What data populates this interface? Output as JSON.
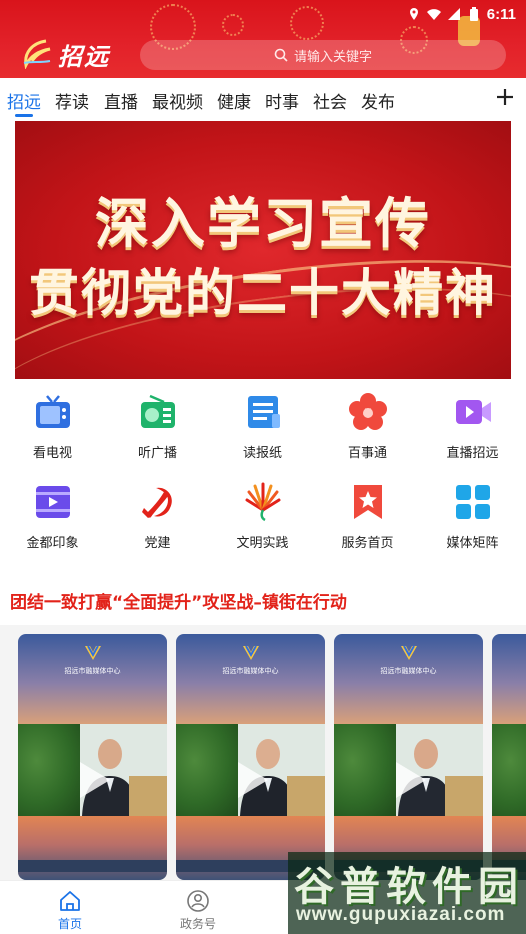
{
  "colors": {
    "header_red": "#e3222a",
    "accent_blue": "#1a73e8",
    "headline_red": "#e2231a"
  },
  "status_bar": {
    "time": "6:11",
    "icons": [
      "location-icon",
      "wifi-icon",
      "signal-icon",
      "battery-icon"
    ]
  },
  "header": {
    "logo_text": "招远",
    "search_placeholder": "请输入关键字"
  },
  "tabs": [
    {
      "label": "招远",
      "active": true
    },
    {
      "label": "荐读"
    },
    {
      "label": "直播"
    },
    {
      "label": "最视频"
    },
    {
      "label": "健康"
    },
    {
      "label": "时事"
    },
    {
      "label": "社会"
    },
    {
      "label": "发布"
    }
  ],
  "banner": {
    "line1": "深入学习宣传",
    "line2": "贯彻党的二十大精神"
  },
  "grid": [
    {
      "label": "看电视",
      "icon": "tv-icon"
    },
    {
      "label": "听广播",
      "icon": "radio-icon"
    },
    {
      "label": "读报纸",
      "icon": "newspaper-icon"
    },
    {
      "label": "百事通",
      "icon": "flower-icon"
    },
    {
      "label": "直播招远",
      "icon": "video-camera-icon"
    },
    {
      "label": "金都印象",
      "icon": "film-icon"
    },
    {
      "label": "党建",
      "icon": "party-emblem-icon"
    },
    {
      "label": "文明实践",
      "icon": "fan-icon"
    },
    {
      "label": "服务首页",
      "icon": "bookmark-star-icon"
    },
    {
      "label": "媒体矩阵",
      "icon": "grid-icon"
    }
  ],
  "headline": "团结一致打赢“全面提升”攻坚战–镇街在行动",
  "video_cards": [
    {
      "caption": "招远市融媒体中心"
    },
    {
      "caption": "招远市融媒体中心"
    },
    {
      "caption": "招远市融媒体中心"
    }
  ],
  "bottom_nav": [
    {
      "label": "首页",
      "icon": "home-icon",
      "active": true
    },
    {
      "label": "政务号",
      "icon": "gov-account-icon"
    }
  ],
  "watermark": {
    "title": "谷普软件园",
    "url": "www.gupuxiazai.com"
  }
}
